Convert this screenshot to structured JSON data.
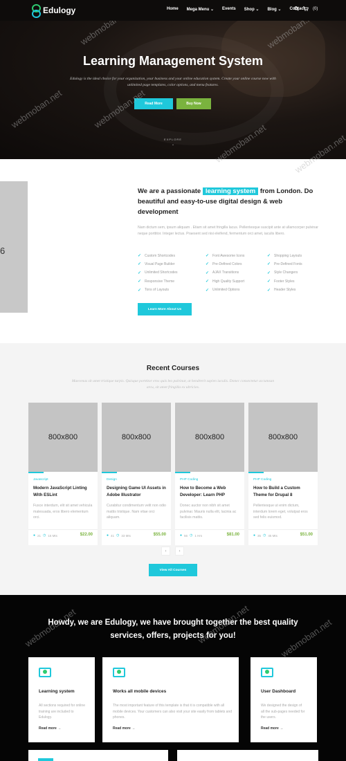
{
  "nav": {
    "logo": "Edulogy",
    "items": [
      "Home",
      "Mega Menu ⌄",
      "Events",
      "Shop ⌄",
      "Blog ⌄",
      "Contact"
    ],
    "cart_count": "(0)"
  },
  "hero": {
    "title": "Learning Management System",
    "subtitle": "Edulogy is the ideal choice for your organization, your business and your online education system. Create your online course now with unlimited page templates, color options, and menu features.",
    "read_more": "Read More",
    "buy_now": "Buy Now",
    "explore": "EXPLORE",
    "explore_arrow": "⌄"
  },
  "about": {
    "image_label": "6",
    "title_before": "We are a passionate",
    "title_highlight": "learning system",
    "title_after": "from London. Do beautiful and easy-to-use digital design & web development",
    "text": "Nam dictum sem, ipsum aliquam . Etiam sit amet fringilla lacus. Pellentesque suscipit ante at ullamcorper pulvinar neque porttitor. Integer lectus. Praesent sed nisi eleifend, fermentum orci amet, iaculis libero.",
    "features": [
      "Custom Shortcodes",
      "Font Awesome Icons",
      "Shopping Layouts",
      "Visual Page Builder",
      "Pre-Defined Colors",
      "Pre-Defined Fonts",
      "Unlimited Shortcodes",
      "AJAX Transitions",
      "Style Changers",
      "Responsive Theme",
      "High Quality Support",
      "Footer Styles",
      "Tons of Layouts",
      "Unlimited Options",
      "Header Styles"
    ],
    "button": "Learn More About Us"
  },
  "courses": {
    "title": "Recent Courses",
    "subtitle": "Maecenas sit amet tristique turpis. Quisque porttitor eros quis leo pulvinar, at hendrerit sapien iaculis. Donec consectetur accumsan arcu, sit amet fringilla ex ultricies.",
    "items": [
      {
        "image": "800x800",
        "category": "Javascript",
        "title": "Modern JavaScript Linting With ESLint",
        "desc": "Fusce interdum, elit sit amet vehicula malesuada, eros libero elementum orci.",
        "students": "21",
        "duration": "15 Mts",
        "price": "$22.00"
      },
      {
        "image": "800x800",
        "category": "Design",
        "title": "Designing Game UI Assets in Adobe Illustrator",
        "desc": "Curabitur condimentum velit non odio mattis tristique. Nam vitae orci aliquam.",
        "students": "41",
        "duration": "33 Mts",
        "price": "$55.00"
      },
      {
        "image": "800x800",
        "category": "PHP Coding",
        "title": "How to Become a Web Developer: Learn PHP",
        "desc": "Donec auctor non nibh sit amet pulvinar. Mauris nulla elit, lacinia ac facilisis mattis.",
        "students": "56",
        "duration": "1 Hrs",
        "price": "$81.00"
      },
      {
        "image": "800x800",
        "category": "PHP Coding",
        "title": "How to Build a Custom Theme for Drupal 8",
        "desc": "Pellentesque ut enim dictum, interdum lorem eget, volutpat eros sed felis euismod.",
        "students": "35",
        "duration": "45 Mts",
        "price": "$51.00"
      }
    ],
    "prev": "‹",
    "next": "›",
    "button": "View All Courses"
  },
  "features_section": {
    "title": "Howdy, we are Edulogy, we have brought together the best quality services, offers, projects for you!",
    "cards": [
      {
        "title": "Learning system",
        "desc": "All sections required for online training are included to Edulogy.",
        "more": "Read more →"
      },
      {
        "title": "Works all mobile devices",
        "desc": "The most important feature of this template is that it is compatible with all mobile devices. Your customers can also visit your site easily from tablets and phones.",
        "more": "Read more →"
      },
      {
        "title": "User Dashboard",
        "desc": "We designed the design of all the sub-pages needed for the users.",
        "more": "Read more →"
      }
    ]
  },
  "watermark": "webmoban.net",
  "colors": {
    "accent": "#1fc8db",
    "green": "#7ab33e",
    "dark": "#0e0c0b"
  },
  "icons": {
    "search": "search-icon",
    "cart": "cart-icon",
    "check": "check-icon",
    "user": "user-icon",
    "clock": "clock-icon"
  }
}
